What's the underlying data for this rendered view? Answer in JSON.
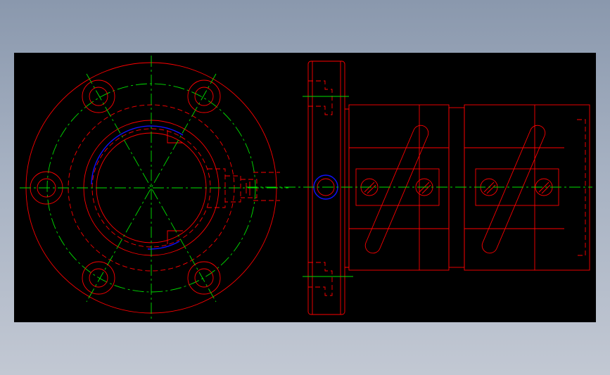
{
  "drawing": {
    "background": "#000000",
    "colors": {
      "outline": "#ff0000",
      "centerline": "#00e000",
      "highlight": "#1010ff",
      "dimension": "#ffffff"
    },
    "views": [
      "front-view-flange",
      "side-view-coupling"
    ]
  }
}
